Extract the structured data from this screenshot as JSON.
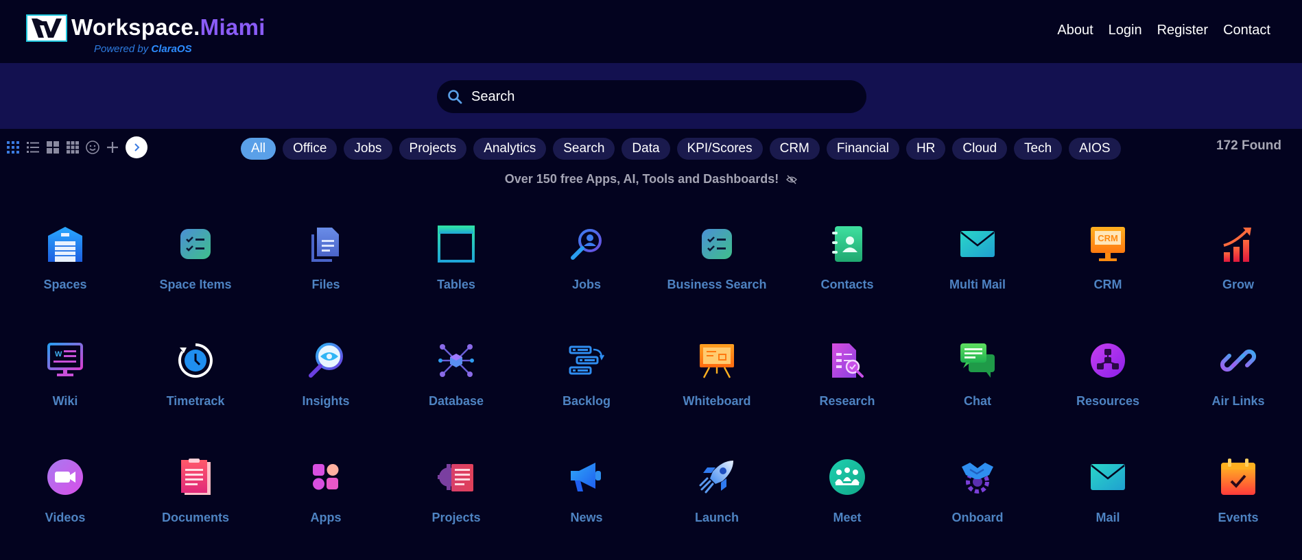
{
  "header": {
    "logo_part1": "Workspace.",
    "logo_part2": "Miami",
    "powered_prefix": "Powered by",
    "powered_brand": "ClaraOS",
    "nav": [
      "About",
      "Login",
      "Register",
      "Contact"
    ]
  },
  "search": {
    "placeholder": "Search"
  },
  "view_tools": [
    "grid-view-icon",
    "list-view-icon",
    "large-grid-icon",
    "small-grid-icon",
    "smiley-icon",
    "add-icon",
    "next-arrow-icon"
  ],
  "filters": [
    "All",
    "Office",
    "Jobs",
    "Projects",
    "Analytics",
    "Search",
    "Data",
    "KPI/Scores",
    "CRM",
    "Financial",
    "HR",
    "Cloud",
    "Tech",
    "AIOS"
  ],
  "active_filter": "All",
  "found": "172 Found",
  "tagline": "Over 150 free Apps, AI, Tools and Dashboards!",
  "apps": [
    {
      "label": "Spaces",
      "icon": "warehouse-icon"
    },
    {
      "label": "Space Items",
      "icon": "checklist-icon"
    },
    {
      "label": "Files",
      "icon": "files-icon"
    },
    {
      "label": "Tables",
      "icon": "table-icon"
    },
    {
      "label": "Jobs",
      "icon": "job-search-icon"
    },
    {
      "label": "Business Search",
      "icon": "checklist-icon"
    },
    {
      "label": "Contacts",
      "icon": "contacts-book-icon"
    },
    {
      "label": "Multi Mail",
      "icon": "envelope-icon"
    },
    {
      "label": "CRM",
      "icon": "crm-monitor-icon"
    },
    {
      "label": "Grow",
      "icon": "growth-chart-icon"
    },
    {
      "label": "Wiki",
      "icon": "wiki-monitor-icon"
    },
    {
      "label": "Timetrack",
      "icon": "clock-icon"
    },
    {
      "label": "Insights",
      "icon": "magnifier-eye-icon"
    },
    {
      "label": "Database",
      "icon": "database-nodes-icon"
    },
    {
      "label": "Backlog",
      "icon": "backlog-list-icon"
    },
    {
      "label": "Whiteboard",
      "icon": "whiteboard-icon"
    },
    {
      "label": "Research",
      "icon": "research-doc-icon"
    },
    {
      "label": "Chat",
      "icon": "chat-bubbles-icon"
    },
    {
      "label": "Resources",
      "icon": "resources-network-icon"
    },
    {
      "label": "Air Links",
      "icon": "chain-link-icon"
    },
    {
      "label": "Videos",
      "icon": "video-camera-icon"
    },
    {
      "label": "Documents",
      "icon": "clipboard-doc-icon"
    },
    {
      "label": "Apps",
      "icon": "apps-grid-icon"
    },
    {
      "label": "Projects",
      "icon": "project-gear-icon"
    },
    {
      "label": "News",
      "icon": "megaphone-icon"
    },
    {
      "label": "Launch",
      "icon": "rocket-icon"
    },
    {
      "label": "Meet",
      "icon": "meeting-people-icon"
    },
    {
      "label": "Onboard",
      "icon": "handshake-gear-icon"
    },
    {
      "label": "Mail",
      "icon": "envelope-icon"
    },
    {
      "label": "Events",
      "icon": "calendar-check-icon"
    }
  ],
  "colors": {
    "background": "#03031f",
    "search_band": "#131150",
    "chip": "#1a1a4d",
    "chip_active": "#5aa0e8",
    "app_label": "#4e83c2",
    "brand_purple": "#8a5cf6"
  }
}
